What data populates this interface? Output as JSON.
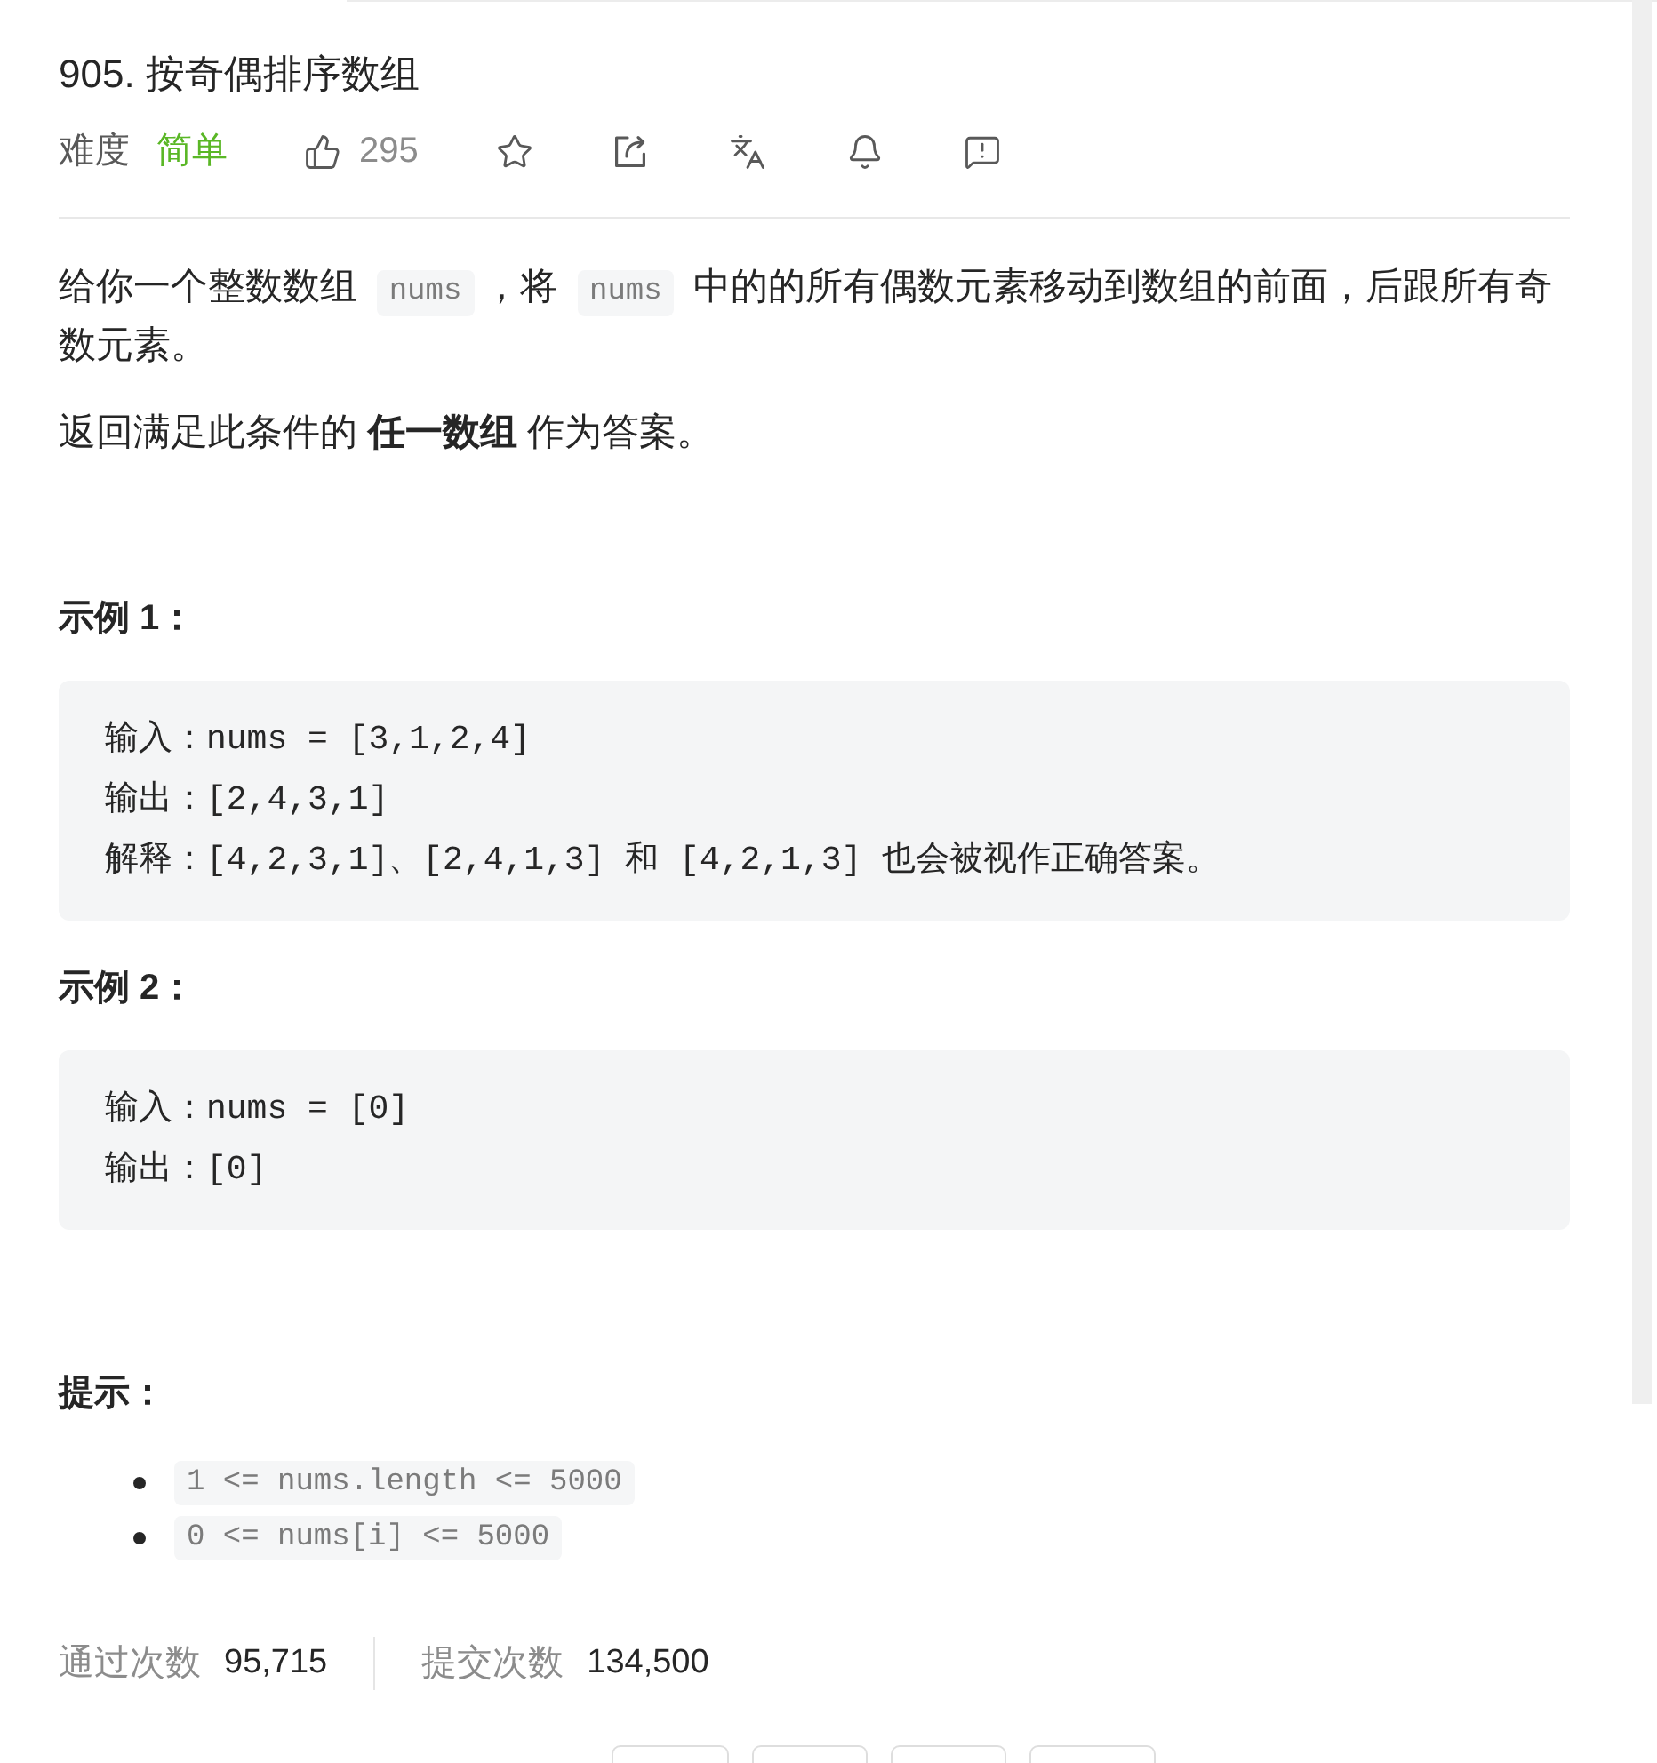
{
  "problem": {
    "title": "905. 按奇偶排序数组",
    "difficulty_label": "难度",
    "difficulty": {
      "text": "简单",
      "kind": "easy"
    },
    "likes": "295"
  },
  "description": [
    {
      "segments": [
        {
          "kind": "text",
          "text": "给你一个整数数组 "
        },
        {
          "kind": "code",
          "text": "nums"
        },
        {
          "kind": "text",
          "text": "，将 "
        },
        {
          "kind": "code",
          "text": "nums"
        },
        {
          "kind": "text",
          "text": " 中的的所有偶数元素移动到数组的前面，后跟所有奇数元素。"
        }
      ]
    },
    {
      "segments": [
        {
          "kind": "text",
          "text": "返回满足此条件的 **任一数组** 作为答案。"
        }
      ]
    }
  ],
  "examples": [
    {
      "heading": "示例 1：",
      "lines": [
        "输入：nums = [3,1,2,4]",
        "输出：[2,4,3,1]",
        "解释：[4,2,3,1]、[2,4,1,3] 和 [4,2,1,3] 也会被视作正确答案。"
      ]
    },
    {
      "heading": "示例 2：",
      "lines": [
        "输入：nums = [0]",
        "输出：[0]"
      ]
    }
  ],
  "constraints": {
    "heading": "提示：",
    "items": [
      "1 <= nums.length <= 5000",
      "0 <= nums[i] <= 5000"
    ]
  },
  "stats": [
    {
      "label": "通过次数",
      "value": "95,715"
    },
    {
      "label": "提交次数",
      "value": "134,500"
    }
  ]
}
